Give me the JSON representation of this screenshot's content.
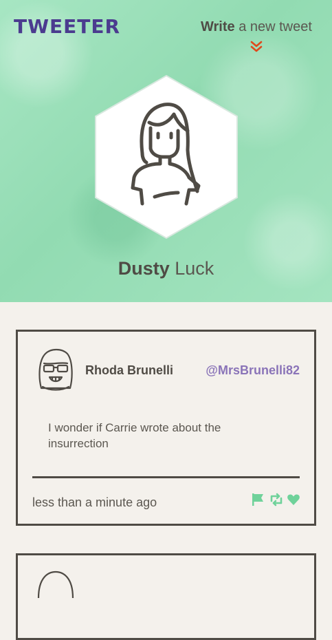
{
  "app": {
    "logo": "TWEETER"
  },
  "nav": {
    "write_bold": "Write",
    "write_rest": " a new tweet"
  },
  "profile": {
    "first_name": "Dusty",
    "last_name": " Luck"
  },
  "tweets": [
    {
      "author": "Rhoda Brunelli",
      "handle": "@MrsBrunelli82",
      "content": "I wonder if Carrie wrote about the insurrection",
      "time": "less than a minute ago"
    }
  ],
  "icons": {
    "chevron": "double-chevron-down-icon",
    "flag": "flag-icon",
    "retweet": "retweet-icon",
    "like": "heart-icon"
  },
  "colors": {
    "hero_bg": "#9fe2bd",
    "logo": "#4b3b8f",
    "handle": "#8a74b8",
    "accent": "#e0491c",
    "action": "#6fd29a",
    "border": "#4f4b45",
    "page_bg": "#f4f1ec"
  }
}
